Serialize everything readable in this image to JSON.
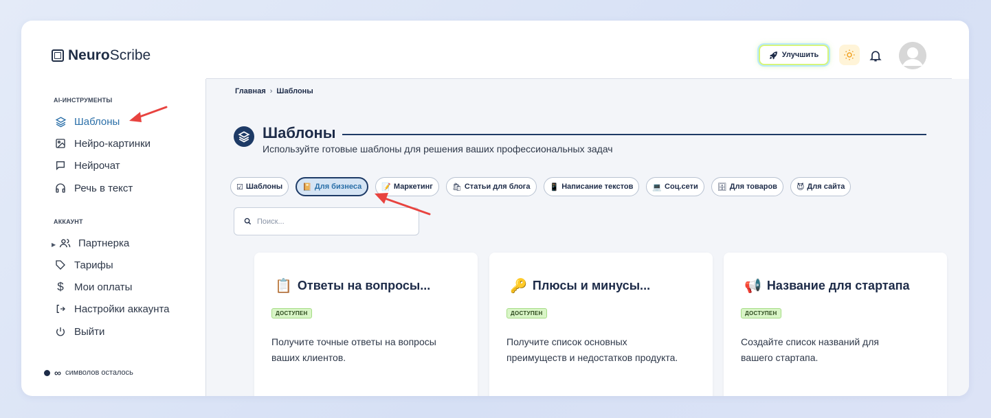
{
  "app": {
    "logo_bold": "Neuro",
    "logo_light": "Scribe"
  },
  "header": {
    "upgrade_label": "Улучшить"
  },
  "sidebar": {
    "section_ai": "AI-ИНСТРУМЕНТЫ",
    "section_account": "АККАУНТ",
    "ai_items": [
      {
        "label": "Шаблоны",
        "icon": "layers-icon"
      },
      {
        "label": "Нейро-картинки",
        "icon": "image-icon"
      },
      {
        "label": "Нейрочат",
        "icon": "chat-icon"
      },
      {
        "label": "Речь в текст",
        "icon": "headphones-icon"
      }
    ],
    "account_items": [
      {
        "label": "Партнерка",
        "icon": "users-icon"
      },
      {
        "label": "Тарифы",
        "icon": "tag-icon"
      },
      {
        "label": "Мои оплаты",
        "icon": "dollar-icon"
      },
      {
        "label": "Настройки аккаунта",
        "icon": "logout-arrow-icon"
      },
      {
        "label": "Выйти",
        "icon": "power-icon"
      }
    ],
    "symbols_value": "∞",
    "symbols_label": "символов осталось"
  },
  "breadcrumb": {
    "home": "Главная",
    "sep": "›",
    "current": "Шаблоны"
  },
  "page": {
    "title": "Шаблоны",
    "subtitle": "Используйте готовые шаблоны для решения ваших профессиональных задач"
  },
  "chips": [
    {
      "emoji": "☑",
      "label": "Шаблоны"
    },
    {
      "emoji": "📔",
      "label": "Для бизнеса"
    },
    {
      "emoji": "📝",
      "label": "Маркетинг"
    },
    {
      "emoji": "🛍",
      "label": "Статьи для блога"
    },
    {
      "emoji": "📱",
      "label": "Написание текстов"
    },
    {
      "emoji": "💻",
      "label": "Соц.сети"
    },
    {
      "emoji": "🗄",
      "label": "Для товаров"
    },
    {
      "emoji": "😈",
      "label": "Для сайта"
    }
  ],
  "search": {
    "placeholder": "Поиск..."
  },
  "cards": [
    {
      "icon": "📋",
      "title": "Ответы на вопросы...",
      "badge": "ДОСТУПЕН",
      "desc": "Получите точные ответы на вопросы ваших клиентов."
    },
    {
      "icon": "🔑",
      "title": "Плюсы и минусы...",
      "badge": "ДОСТУПЕН",
      "desc": "Получите список основных преимуществ и недостатков продукта."
    },
    {
      "icon": "📢",
      "title": "Название для стартапа",
      "badge": "ДОСТУПЕН",
      "desc": "Создайте список названий для вашего стартапа."
    }
  ],
  "colors": {
    "accent": "#2a6fa8",
    "navy": "#1d3a66",
    "badge_bg": "#d9f5c7",
    "arrow": "#e8433f"
  }
}
